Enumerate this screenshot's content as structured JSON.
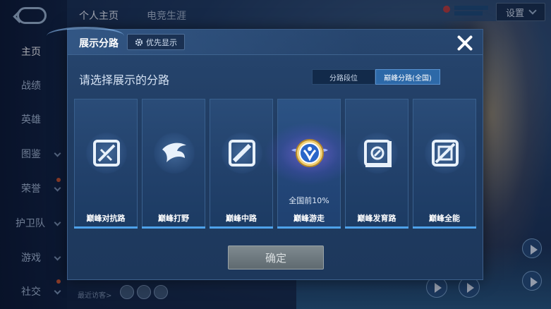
{
  "topbar": {
    "tabs": [
      "个人主页",
      "电竞生涯"
    ],
    "settings_label": "设置"
  },
  "sidebar": {
    "items": [
      {
        "label": "主页",
        "active": true,
        "chevron": false
      },
      {
        "label": "战绩",
        "active": false,
        "chevron": false
      },
      {
        "label": "英雄",
        "active": false,
        "chevron": false
      },
      {
        "label": "图鉴",
        "active": false,
        "chevron": true
      },
      {
        "label": "荣誉",
        "active": false,
        "chevron": true
      },
      {
        "label": "护卫队",
        "active": false,
        "chevron": true
      },
      {
        "label": "游戏",
        "active": false,
        "chevron": true
      },
      {
        "label": "社交",
        "active": false,
        "chevron": true
      }
    ]
  },
  "footer": {
    "recent_visitors_label": "最近访客>"
  },
  "dialog": {
    "title": "展示分路",
    "priority_label": "优先显示",
    "subtitle": "请选择展示的分路",
    "segments": [
      "分路段位",
      "巅峰分路(全国)"
    ],
    "selected_segment": 1,
    "cards": [
      {
        "label": "巅峰对抗路",
        "icon": "clash-lane-icon",
        "rank": ""
      },
      {
        "label": "巅峰打野",
        "icon": "jungle-icon",
        "rank": ""
      },
      {
        "label": "巅峰中路",
        "icon": "mid-lane-icon",
        "rank": ""
      },
      {
        "label": "巅峰游走",
        "icon": "roam-badge-icon",
        "rank": "全国前10%",
        "selected": true
      },
      {
        "label": "巅峰发育路",
        "icon": "farm-lane-icon",
        "rank": ""
      },
      {
        "label": "巅峰全能",
        "icon": "all-round-icon",
        "rank": ""
      }
    ],
    "confirm_label": "确定"
  },
  "colors": {
    "accent": "#4ea2ea",
    "dialog_bg": "#22416b",
    "segment_active": "#2d69a8",
    "confirm_disabled": "#6f7a80"
  }
}
